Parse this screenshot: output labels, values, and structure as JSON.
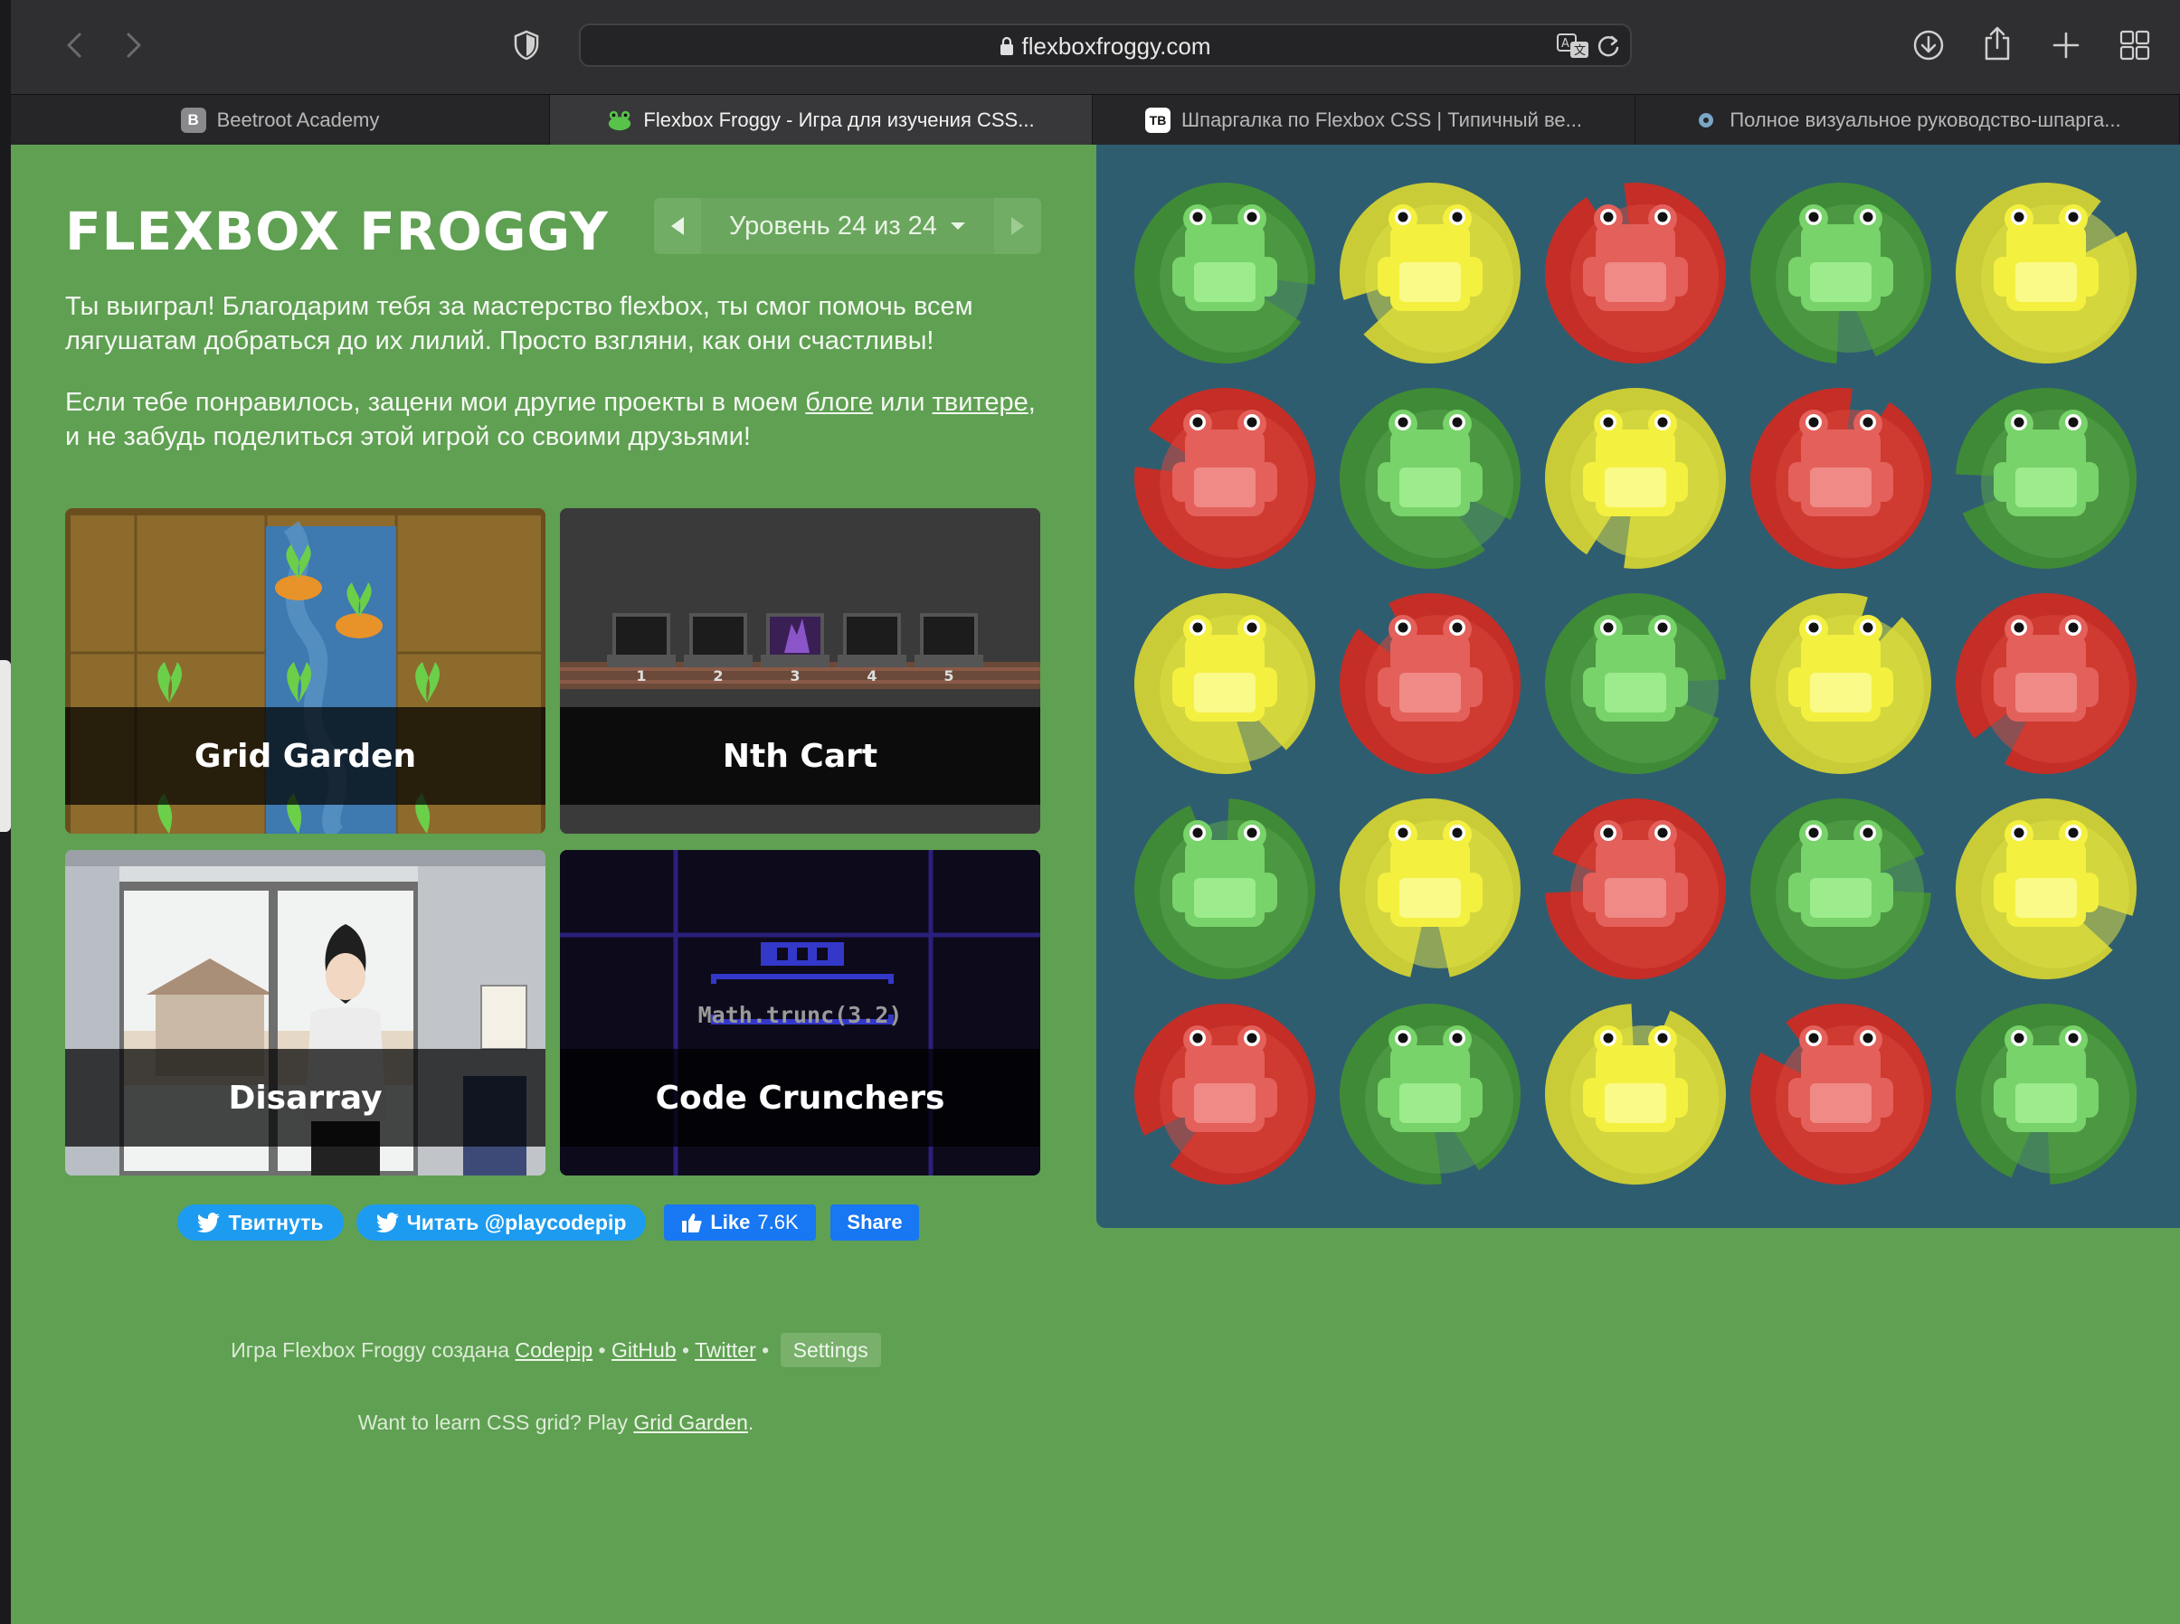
{
  "browser": {
    "url": "flexboxfroggy.com",
    "tabs": [
      {
        "label": "Beetroot Academy",
        "favicon": "B",
        "active": false
      },
      {
        "label": "Flexbox Froggy - Игра для изучения CSS...",
        "favicon": "frog",
        "active": true
      },
      {
        "label": "Шпаргалка по Flexbox CSS | Типичный ве...",
        "favicon": "TB",
        "active": false
      },
      {
        "label": "Полное визуальное руководство-шпарга...",
        "favicon": "gear",
        "active": false
      }
    ]
  },
  "header": {
    "title": "FLEXBOX FROGGY",
    "level_label": "Уровень 24 из 24"
  },
  "intro": {
    "win_text": "Ты выиграл! Благодарим тебя за мастерство flexbox, ты смог помочь всем лягушатам добраться до их лилий. Просто взгляни, как они счастливы!",
    "share_prefix": "Если тебе понравилось, зацени мои другие проекты в моем ",
    "blog_link": "блоге",
    "or": " или ",
    "twitter_link": "твитере",
    "share_suffix": ", и не забудь поделиться этой игрой со своими друзьями!"
  },
  "projects": [
    {
      "title": "Grid Garden"
    },
    {
      "title": "Nth Cart"
    },
    {
      "title": "Disarray"
    },
    {
      "title": "Code Crunchers"
    }
  ],
  "nth_cart_numbers": [
    "1",
    "2",
    "3",
    "4",
    "5"
  ],
  "code_crunchers_code": "Math.trunc(3.2)",
  "social": {
    "tweet": "Твитнуть",
    "follow": "Читать @playcodepip",
    "like": "Like",
    "like_count": "7.6K",
    "share": "Share"
  },
  "footer": {
    "made_by": "Игра Flexbox Froggy создана",
    "codepip": "Codepip",
    "github": "GitHub",
    "twitter": "Twitter",
    "settings": "Settings",
    "grid_prompt": "Want to learn CSS grid? Play",
    "grid_link": "Grid Garden",
    "period": "."
  },
  "pond": {
    "rows": [
      [
        "green",
        "yellow",
        "red",
        "green",
        "yellow"
      ],
      [
        "red",
        "green",
        "yellow",
        "red",
        "green"
      ],
      [
        "yellow",
        "red",
        "green",
        "yellow",
        "red"
      ],
      [
        "green",
        "yellow",
        "red",
        "green",
        "yellow"
      ],
      [
        "red",
        "green",
        "yellow",
        "red",
        "green"
      ]
    ],
    "colors": {
      "green": {
        "pad": "#3f8a37",
        "pad_shade": "#58a34a",
        "frog": "#78d36a",
        "frog_light": "#9ceb8c"
      },
      "yellow": {
        "pad": "#c9cc36",
        "pad_shade": "#dddf45",
        "frog": "#f4f040",
        "frog_light": "#fafa88"
      },
      "red": {
        "pad": "#c42e26",
        "pad_shade": "#d9453a",
        "frog": "#e4605a",
        "frog_light": "#ef8a86"
      }
    }
  },
  "colors": {
    "page_bg": "#5fa052",
    "pond_bg": "#2f5d70",
    "twitter_blue": "#1d9bf0",
    "facebook_blue": "#1877f2"
  }
}
